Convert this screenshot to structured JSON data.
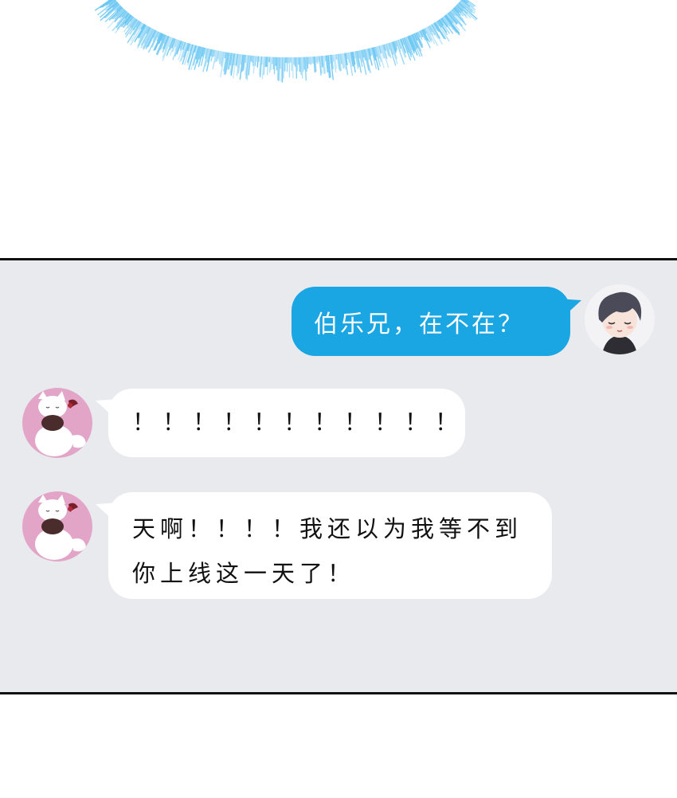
{
  "messages": [
    {
      "sender": "self",
      "text": "伯乐兄，在不在？",
      "color": "#1aa5e3"
    },
    {
      "sender": "friend",
      "text": "！！！！！！！！！！！",
      "color": "#ffffff"
    },
    {
      "sender": "friend",
      "lines": [
        "天啊！！！！我还以为我等不到",
        "你上线这一天了！"
      ],
      "color": "#ffffff"
    }
  ],
  "colors": {
    "panel_background": "#e9eaee",
    "friend_avatar_background": "#e2a5c8",
    "burst": "#62c3f2"
  },
  "icons": {
    "self_avatar": "boy-avatar-icon",
    "friend_avatar": "white-cat-avatar-icon"
  }
}
